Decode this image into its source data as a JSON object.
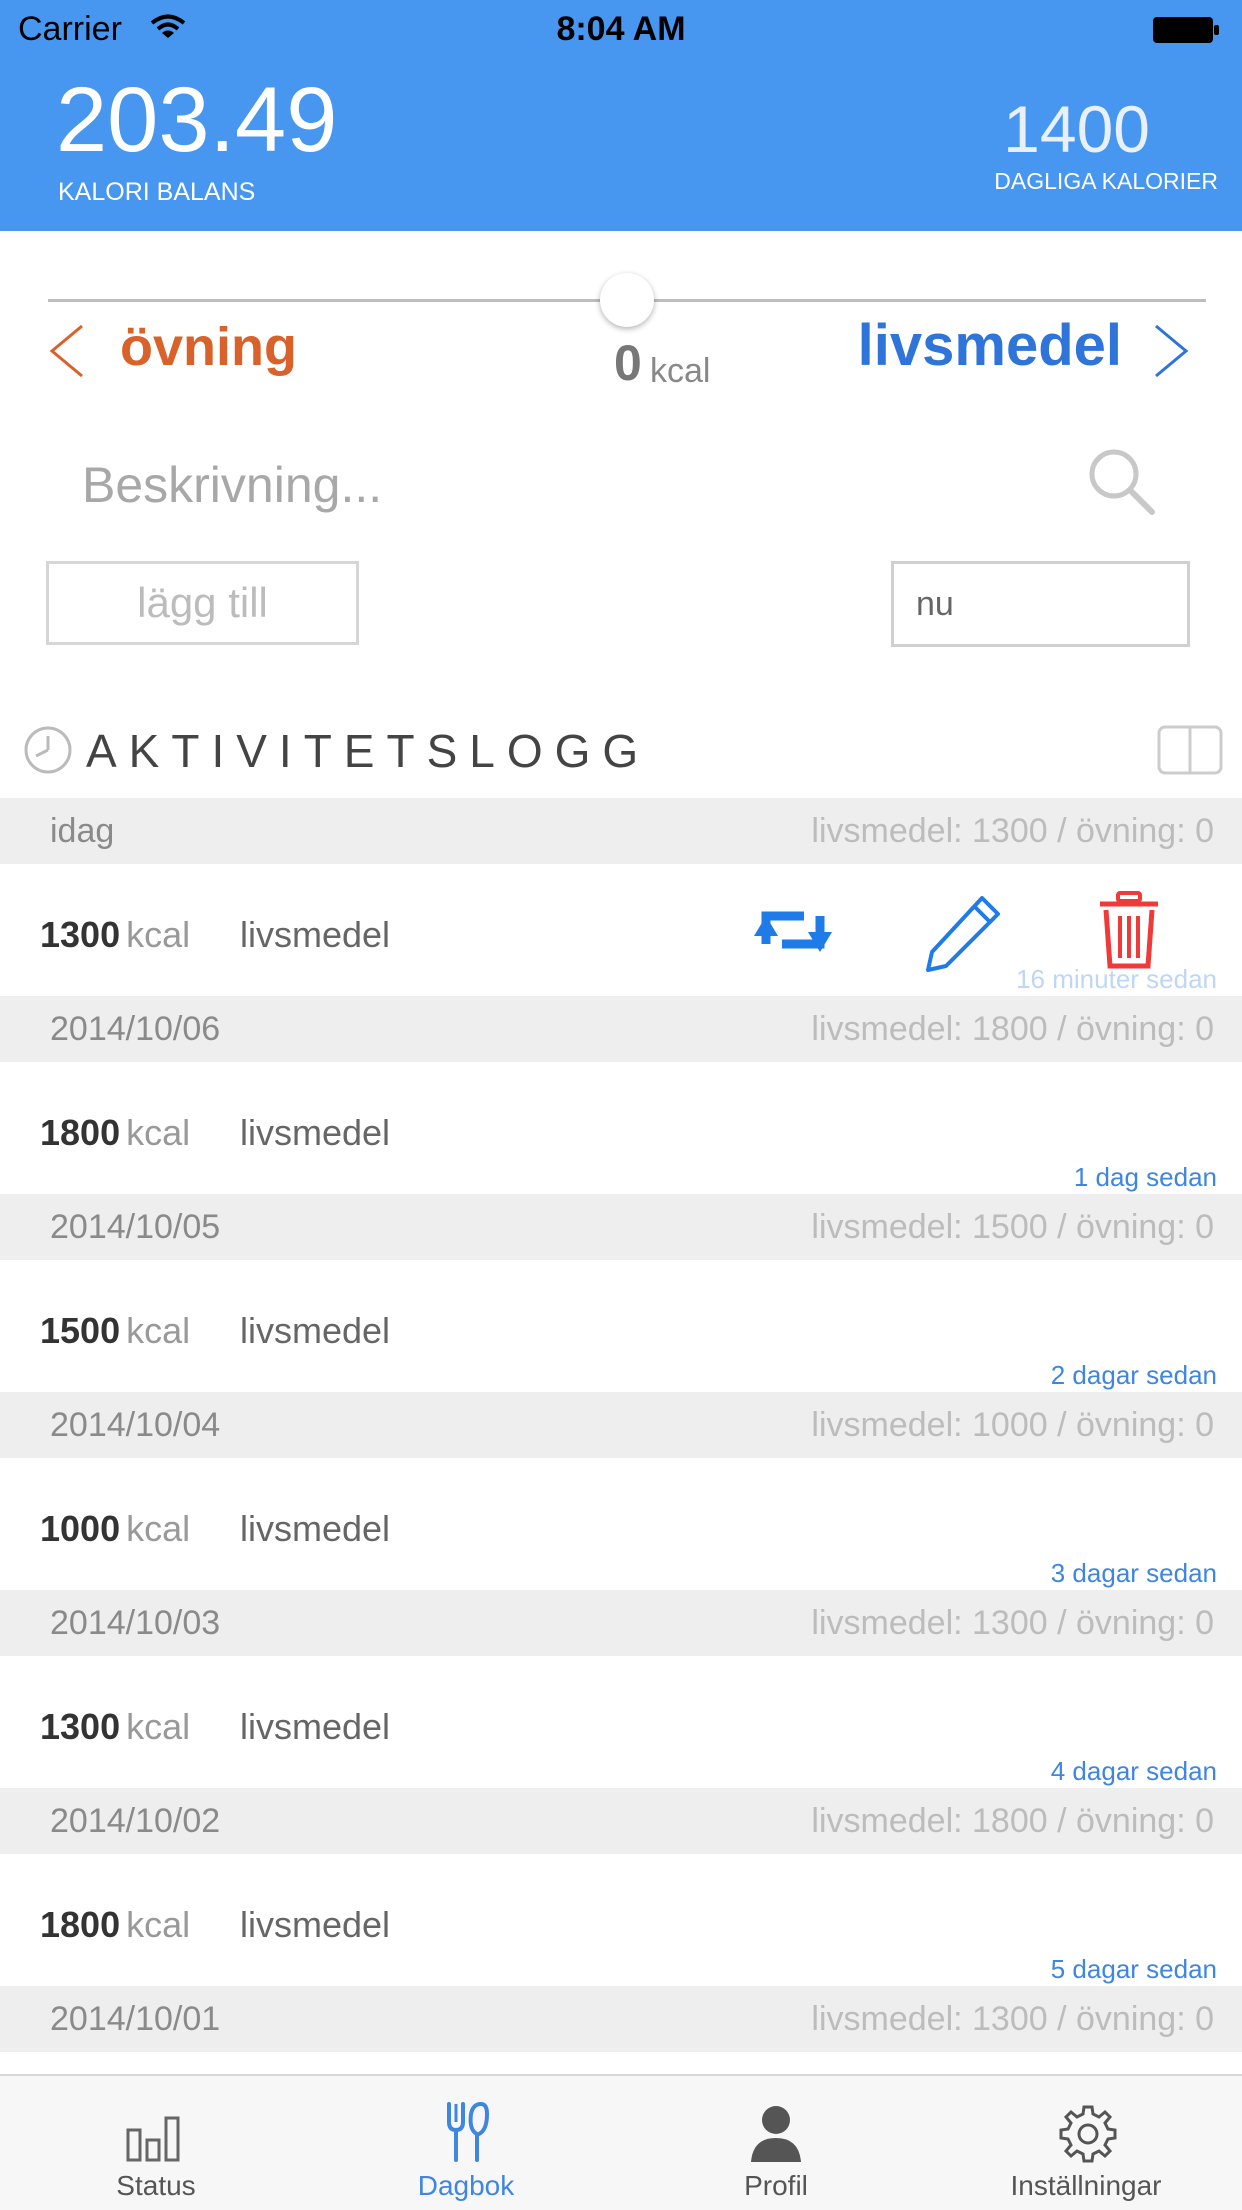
{
  "status_bar": {
    "carrier": "Carrier",
    "time": "8:04 AM"
  },
  "header": {
    "balance_value": "203.49",
    "balance_label": "KALORI BALANS",
    "daily_value": "1400",
    "daily_label": "DAGLIGA KALORIER"
  },
  "slider": {
    "left_label": "övning",
    "right_label": "livsmedel",
    "value": "0",
    "unit": "kcal",
    "position_fraction": 0.5
  },
  "form": {
    "description_placeholder": "Beskrivning...",
    "add_button": "lägg till",
    "time_value": "nu"
  },
  "log": {
    "title": "AKTIVITETSLOGG",
    "days": [
      {
        "date": "idag",
        "summary": "livsmedel: 1300 / övning: 0",
        "kcal": "1300",
        "unit": "kcal",
        "type": "livsmedel",
        "ago": "16 minuter sedan"
      },
      {
        "date": "2014/10/06",
        "summary": "livsmedel: 1800 / övning: 0",
        "kcal": "1800",
        "unit": "kcal",
        "type": "livsmedel",
        "ago": "1 dag sedan"
      },
      {
        "date": "2014/10/05",
        "summary": "livsmedel: 1500 / övning: 0",
        "kcal": "1500",
        "unit": "kcal",
        "type": "livsmedel",
        "ago": "2 dagar sedan"
      },
      {
        "date": "2014/10/04",
        "summary": "livsmedel: 1000 / övning: 0",
        "kcal": "1000",
        "unit": "kcal",
        "type": "livsmedel",
        "ago": "3 dagar sedan"
      },
      {
        "date": "2014/10/03",
        "summary": "livsmedel: 1300 / övning: 0",
        "kcal": "1300",
        "unit": "kcal",
        "type": "livsmedel",
        "ago": "4 dagar sedan"
      },
      {
        "date": "2014/10/02",
        "summary": "livsmedel: 1800 / övning: 0",
        "kcal": "1800",
        "unit": "kcal",
        "type": "livsmedel",
        "ago": "5 dagar sedan"
      },
      {
        "date": "2014/10/01",
        "summary": "livsmedel: 1300 / övning: 0"
      }
    ]
  },
  "tabs": [
    {
      "label": "Status",
      "icon": "bar-chart-icon",
      "active": false
    },
    {
      "label": "Dagbok",
      "icon": "fork-knife-icon",
      "active": true
    },
    {
      "label": "Profil",
      "icon": "person-icon",
      "active": false
    },
    {
      "label": "Inställningar",
      "icon": "gear-icon",
      "active": false
    }
  ],
  "colors": {
    "header_bg": "#4796EF",
    "exercise": "#D9612A",
    "food": "#2F74D8",
    "delete": "#F03A3A",
    "accent": "#3F86E0"
  }
}
